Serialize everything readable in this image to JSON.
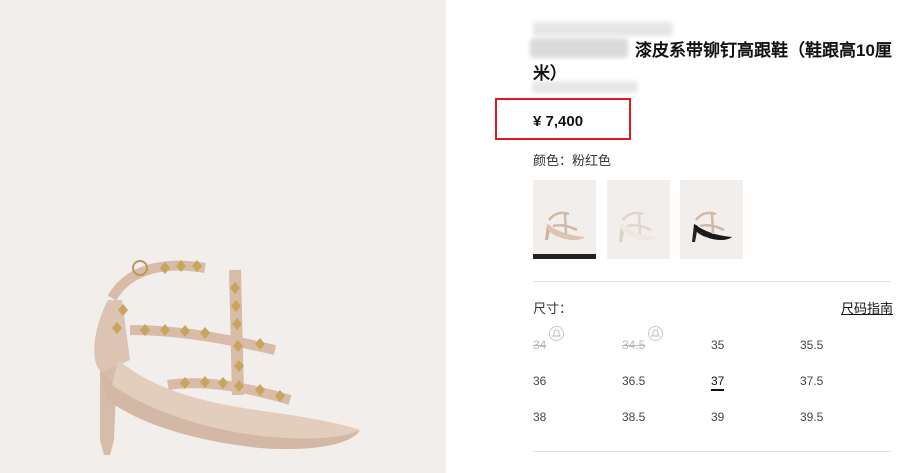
{
  "product": {
    "title": "漆皮系带铆钉高跟鞋（鞋跟高10厘米）",
    "price": "¥ 7,400",
    "color_text": "颜色：粉红色"
  },
  "colors": {
    "accent_red": "#e0181f",
    "gallery_bg": "#f1eeeb",
    "nude": "#dcc3b2",
    "ivory": "#eee8de",
    "black": "#1a1a1a",
    "stud_gold": "#c9a45c"
  },
  "swatches": [
    {
      "variant": "nude",
      "selected": true
    },
    {
      "variant": "ivory",
      "selected": false
    },
    {
      "variant": "black",
      "selected": false
    }
  ],
  "size_section": {
    "label": "尺寸：",
    "guide_link": "尺码指南"
  },
  "sizes": [
    {
      "label": "34",
      "available": false,
      "notify_icon": "bell-icon"
    },
    {
      "label": "34.5",
      "available": false,
      "notify_icon": "bell-icon"
    },
    {
      "label": "35",
      "available": true
    },
    {
      "label": "35.5",
      "available": true
    },
    {
      "label": "36",
      "available": true
    },
    {
      "label": "36.5",
      "available": true
    },
    {
      "label": "37",
      "available": true,
      "selected": true
    },
    {
      "label": "37.5",
      "available": true
    },
    {
      "label": "38",
      "available": true
    },
    {
      "label": "38.5",
      "available": true
    },
    {
      "label": "39",
      "available": true
    },
    {
      "label": "39.5",
      "available": true
    }
  ]
}
